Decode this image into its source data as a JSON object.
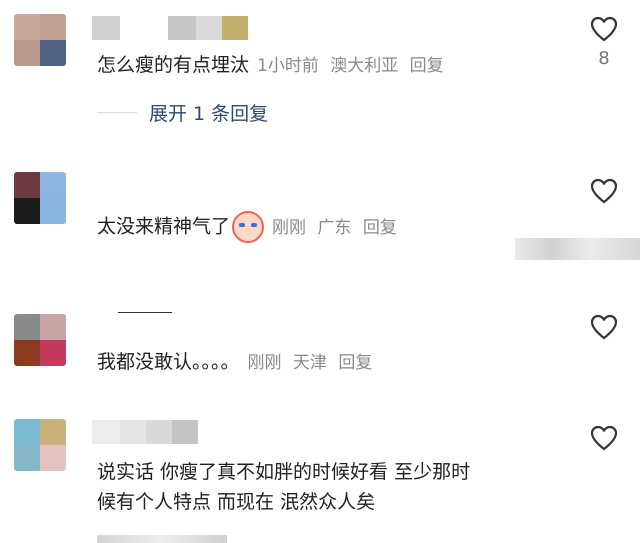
{
  "comments": [
    {
      "text": "怎么瘦的有点埋汰",
      "time": "1小时前",
      "location": "澳大利亚",
      "reply": "回复",
      "likes": "8",
      "avatar_colors": [
        "#c8a89a",
        "#bf9f8f",
        "#b79a8c",
        "#4e6383"
      ],
      "name_colors": [
        "#cfcfcf",
        "#c6c6c6",
        "#d9d9d9",
        "#c3b06c"
      ]
    },
    {
      "text": "太没来精神气了",
      "time": "刚刚",
      "location": "广东",
      "reply": "回复",
      "likes": "",
      "avatar_colors": [
        "#6d3b3f",
        "#8fb6e0",
        "#1c1c1c",
        "#8ab6df"
      ]
    },
    {
      "text": "我都没敢认。。。。",
      "time": "刚刚",
      "location": "天津",
      "reply": "回复",
      "likes": "",
      "avatar_colors": [
        "#8a8a8a",
        "#c9a4a4",
        "#8c3b20",
        "#c33a5e"
      ]
    },
    {
      "text_line1": "说实话 你瘦了真不如胖的时候好看 至少那时",
      "text_line2": "候有个人特点 而现在 泯然众人矣",
      "likes": "",
      "avatar_colors": [
        "#79b9d3",
        "#c8b27a",
        "#85b7c9",
        "#e6c2bf"
      ],
      "name_colors": [
        "#eeeeee",
        "#e4e4e4",
        "#d8d8d8",
        "#c4c4c4"
      ]
    }
  ],
  "expand_replies": "展开 1 条回复",
  "icons": {
    "like": "heart-outline-icon",
    "emoji": "crying-face-emoji"
  },
  "colors": {
    "meta": "#8a8a8a",
    "link": "#2d4a6e"
  }
}
